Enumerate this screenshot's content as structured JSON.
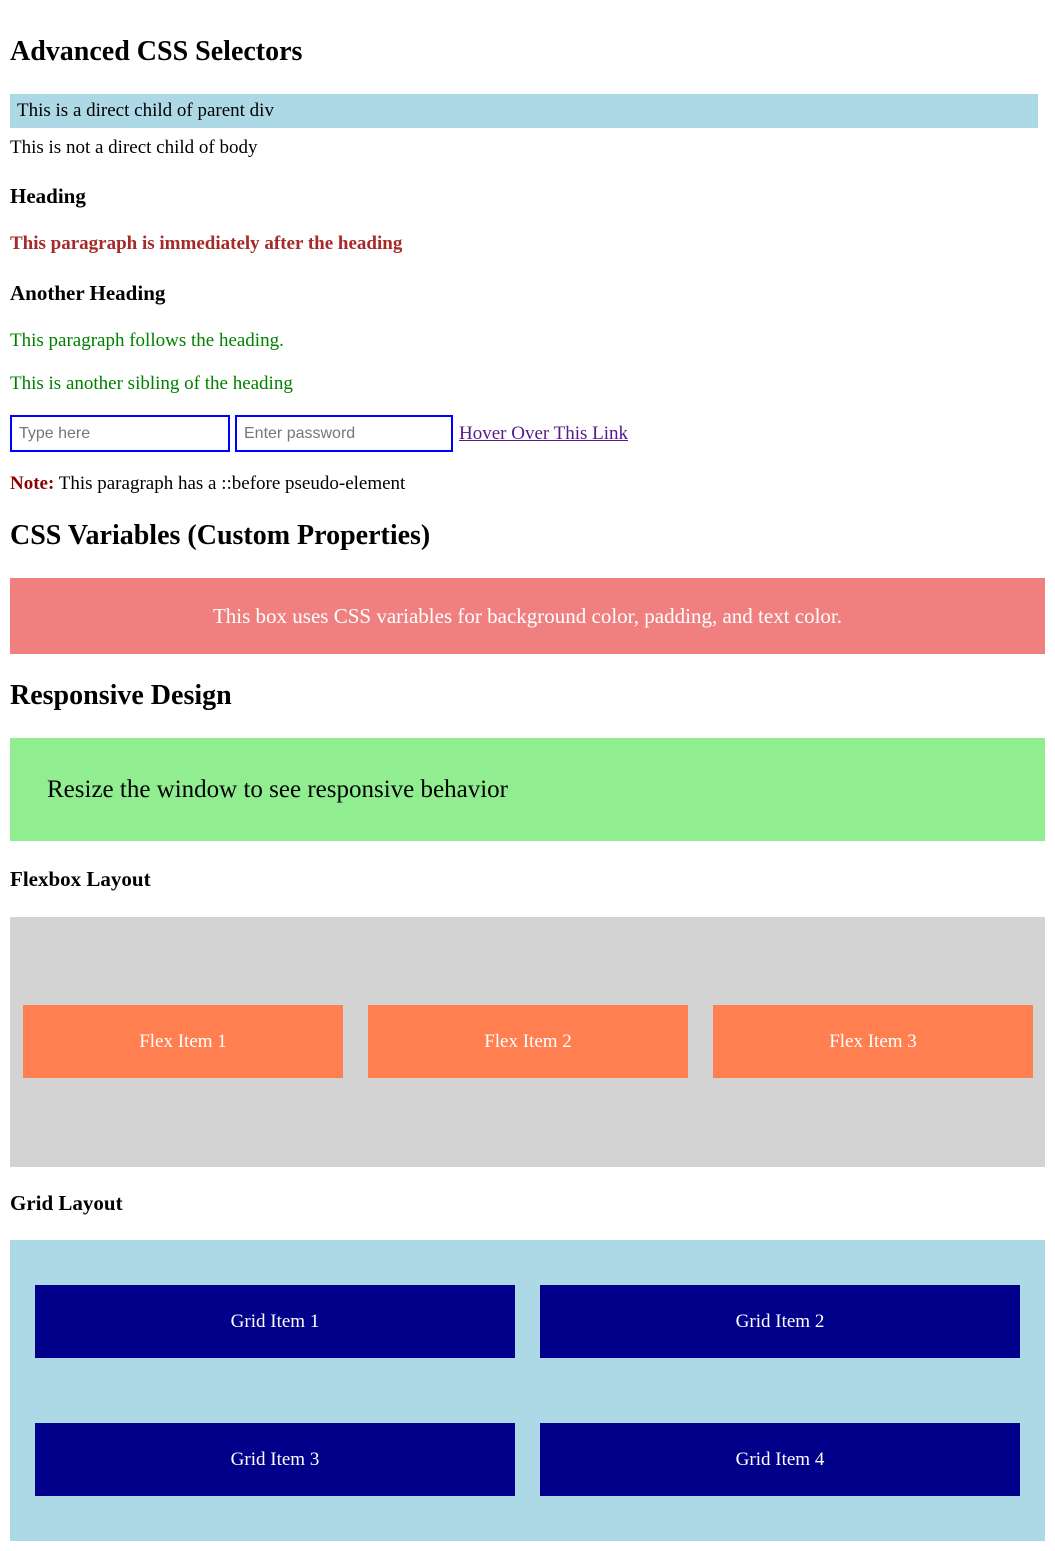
{
  "selectors": {
    "title": "Advanced CSS Selectors",
    "direct_child_text": "This is a direct child of parent div",
    "not_direct_child_text": "This is not a direct child of body",
    "heading_1": "Heading",
    "adjacent_paragraph": "This paragraph is immediately after the heading",
    "heading_2": "Another Heading",
    "sibling_paragraph_1": "This paragraph follows the heading.",
    "sibling_paragraph_2": "This is another sibling of the heading",
    "text_input": {
      "placeholder": "Type here",
      "value": ""
    },
    "password_input": {
      "placeholder": "Enter password",
      "value": ""
    },
    "hover_link": "Hover Over This Link",
    "note_label": "Note:",
    "note_text": " This paragraph has a ::before pseudo-element"
  },
  "variables": {
    "title": "CSS Variables (Custom Properties)",
    "box_text": "This box uses CSS variables for background color, padding, and text color."
  },
  "responsive": {
    "title": "Responsive Design",
    "box_text": "Resize the window to see responsive behavior"
  },
  "flexbox": {
    "title": "Flexbox Layout",
    "items": [
      "Flex Item 1",
      "Flex Item 2",
      "Flex Item 3"
    ]
  },
  "grid": {
    "title": "Grid Layout",
    "items": [
      "Grid Item 1",
      "Grid Item 2",
      "Grid Item 3",
      "Grid Item 4"
    ]
  },
  "colors": {
    "direct_child_bg": "#add8e6",
    "adjacent_text": "#a52a2a",
    "sibling_text": "#008000",
    "input_border": "#0000ff",
    "link": "#551a8b",
    "note_label": "#8b0000",
    "variables_box_bg": "#f08080",
    "responsive_box_bg": "#90ee90",
    "flex_container_bg": "#d3d3d3",
    "flex_item_bg": "#ff7f50",
    "grid_container_bg": "#add8e6",
    "grid_item_bg": "#00008b"
  }
}
